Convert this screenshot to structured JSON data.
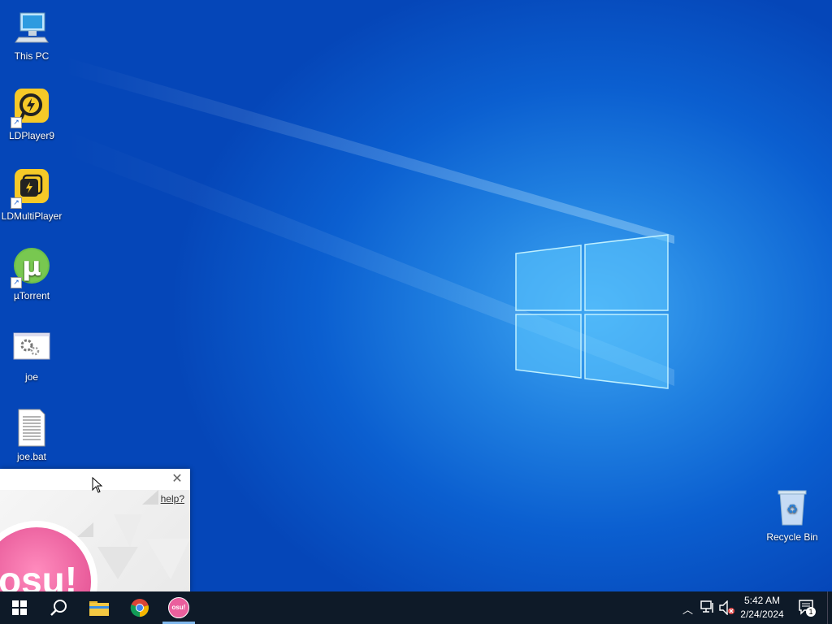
{
  "desktop": {
    "icons": [
      {
        "label": "This PC",
        "icon": "computer-icon"
      },
      {
        "label": "LDPlayer9",
        "icon": "ldplayer-icon"
      },
      {
        "label": "LDMultiPlayer",
        "icon": "ldmultiplayer-icon"
      },
      {
        "label": "µTorrent",
        "icon": "utorrent-icon"
      },
      {
        "label": "joe",
        "icon": "settings-file-icon"
      },
      {
        "label": "joe.bat",
        "icon": "batch-file-icon"
      },
      {
        "label": "Recycle Bin",
        "icon": "recycle-bin-icon"
      }
    ]
  },
  "osu_window": {
    "help_link": "help?",
    "logo_text": "osu!"
  },
  "taskbar": {
    "apps": [
      "start-icon",
      "search-icon",
      "file-explorer-icon",
      "chrome-icon",
      "osu-icon"
    ],
    "osu_app_label": "osu!",
    "clock_time": "5:42 AM",
    "clock_date": "2/24/2024",
    "notification_count": "1"
  },
  "colors": {
    "desktop_blue": "#0b5fd0",
    "taskbar": "#0e1a28",
    "osu_pink": "#ea5f9d"
  }
}
